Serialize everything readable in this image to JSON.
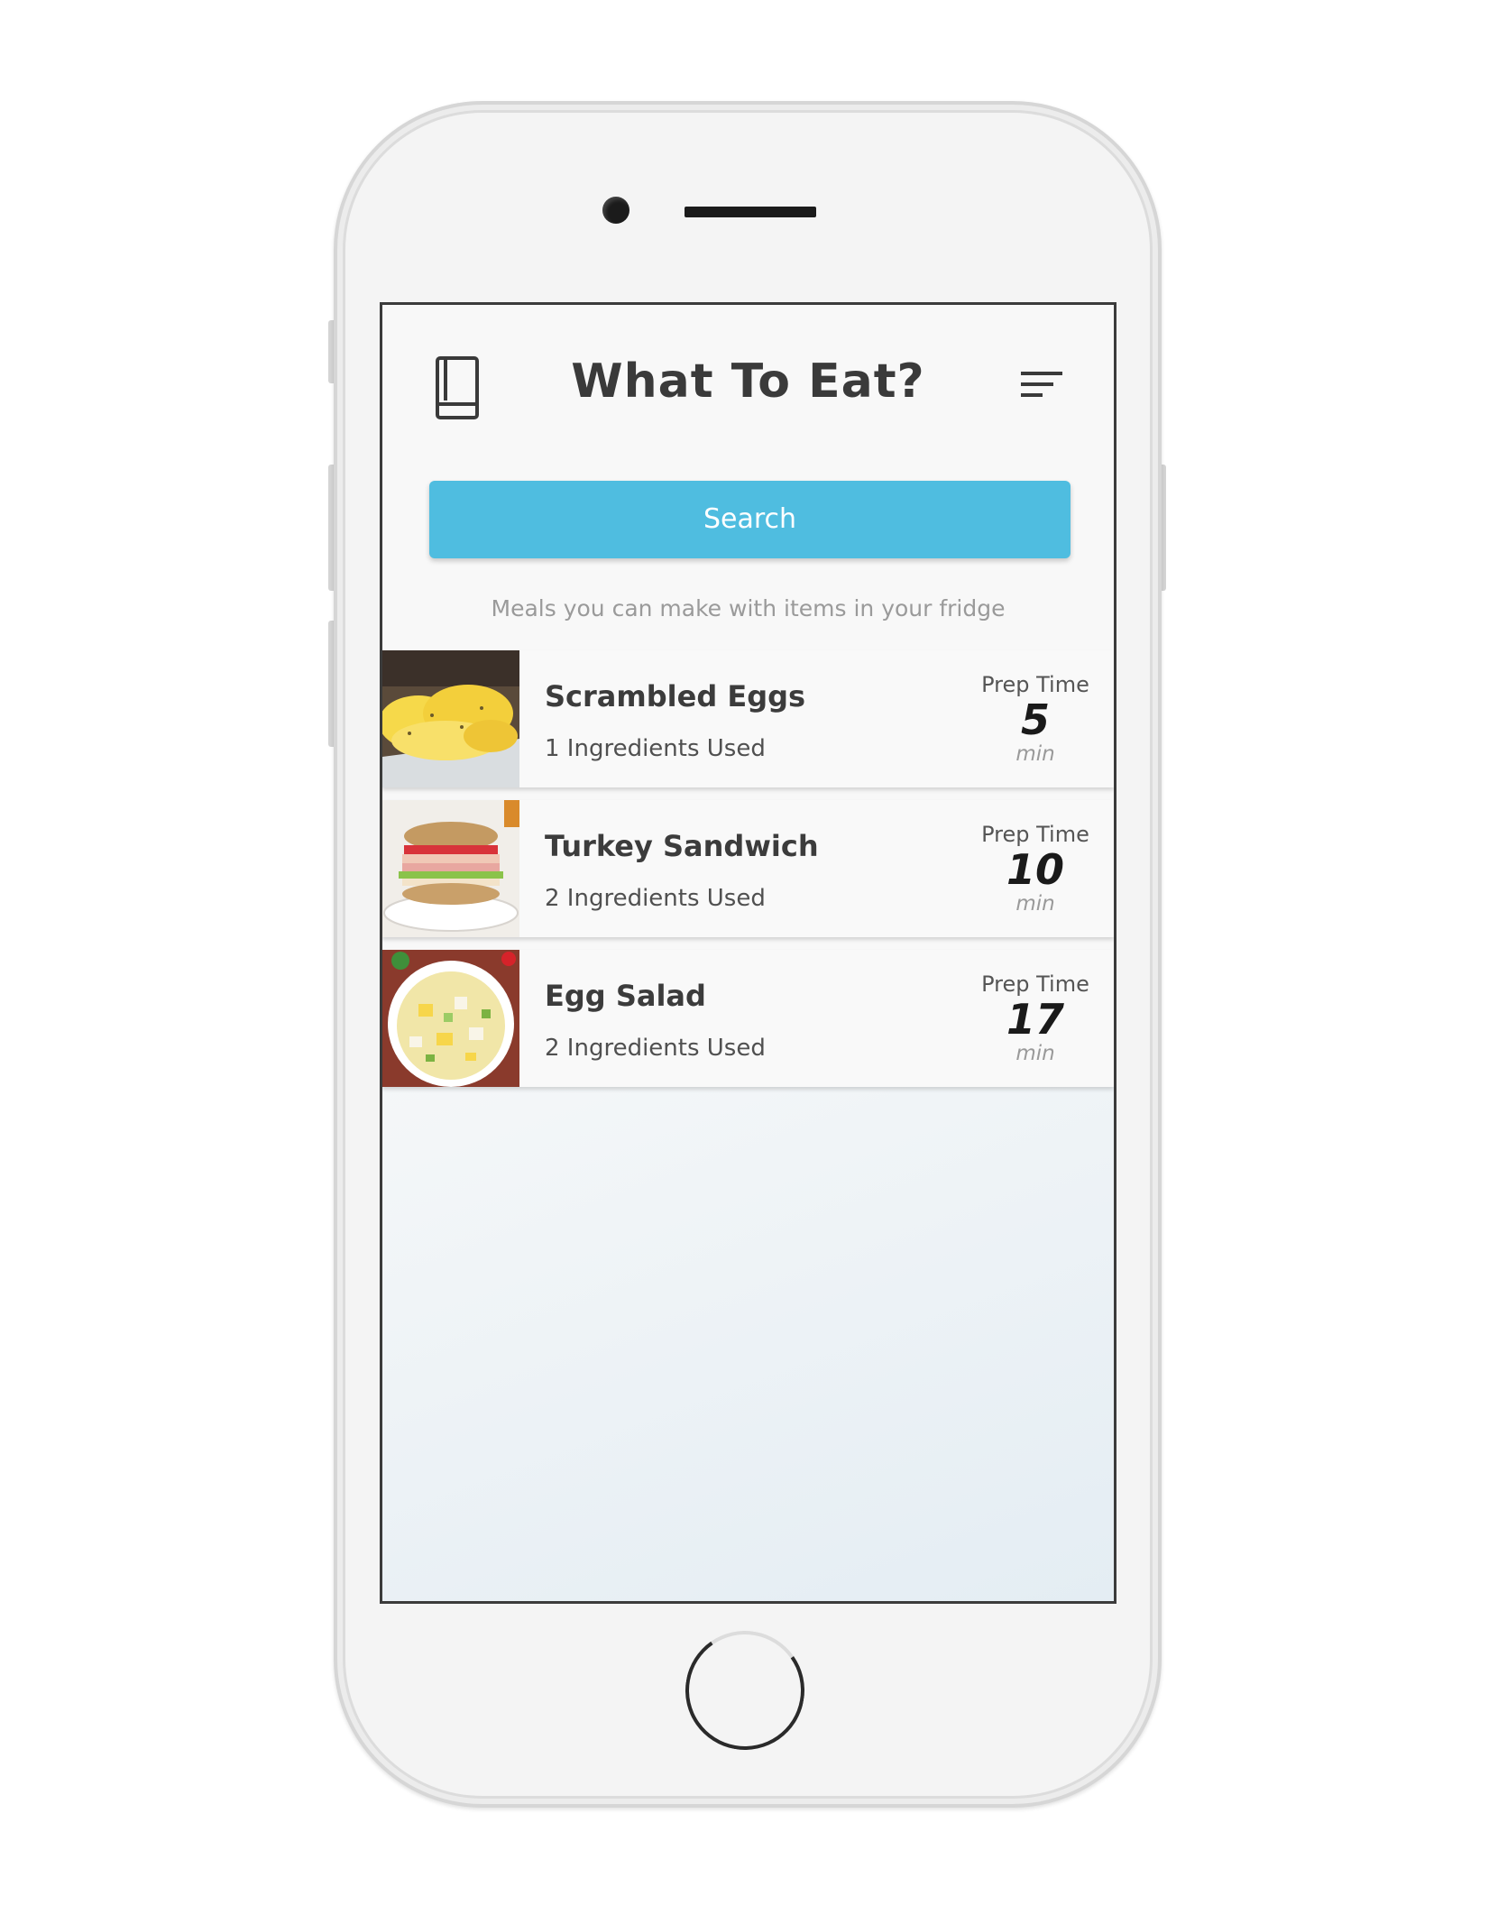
{
  "header": {
    "title": "What To Eat?",
    "left_icon": "recipe-book-icon",
    "right_icon": "filter-menu-icon"
  },
  "search": {
    "button_label": "Search",
    "hint": "Meals you can make with items in your fridge"
  },
  "meals": [
    {
      "name": "Scrambled Eggs",
      "ingredients": "1 Ingredients Used",
      "prep_label": "Prep Time",
      "prep_value": "5",
      "prep_unit": "min",
      "image": "scrambled-eggs-photo"
    },
    {
      "name": "Turkey Sandwich",
      "ingredients": "2 Ingredients Used",
      "prep_label": "Prep Time",
      "prep_value": "10",
      "prep_unit": "min",
      "image": "turkey-sandwich-photo"
    },
    {
      "name": "Egg Salad",
      "ingredients": "2 Ingredients Used",
      "prep_label": "Prep Time",
      "prep_value": "17",
      "prep_unit": "min",
      "image": "egg-salad-photo"
    }
  ],
  "colors": {
    "accent": "#4fbde0",
    "title_text": "#3a3a3a",
    "hint_text": "#9a9a9a"
  }
}
